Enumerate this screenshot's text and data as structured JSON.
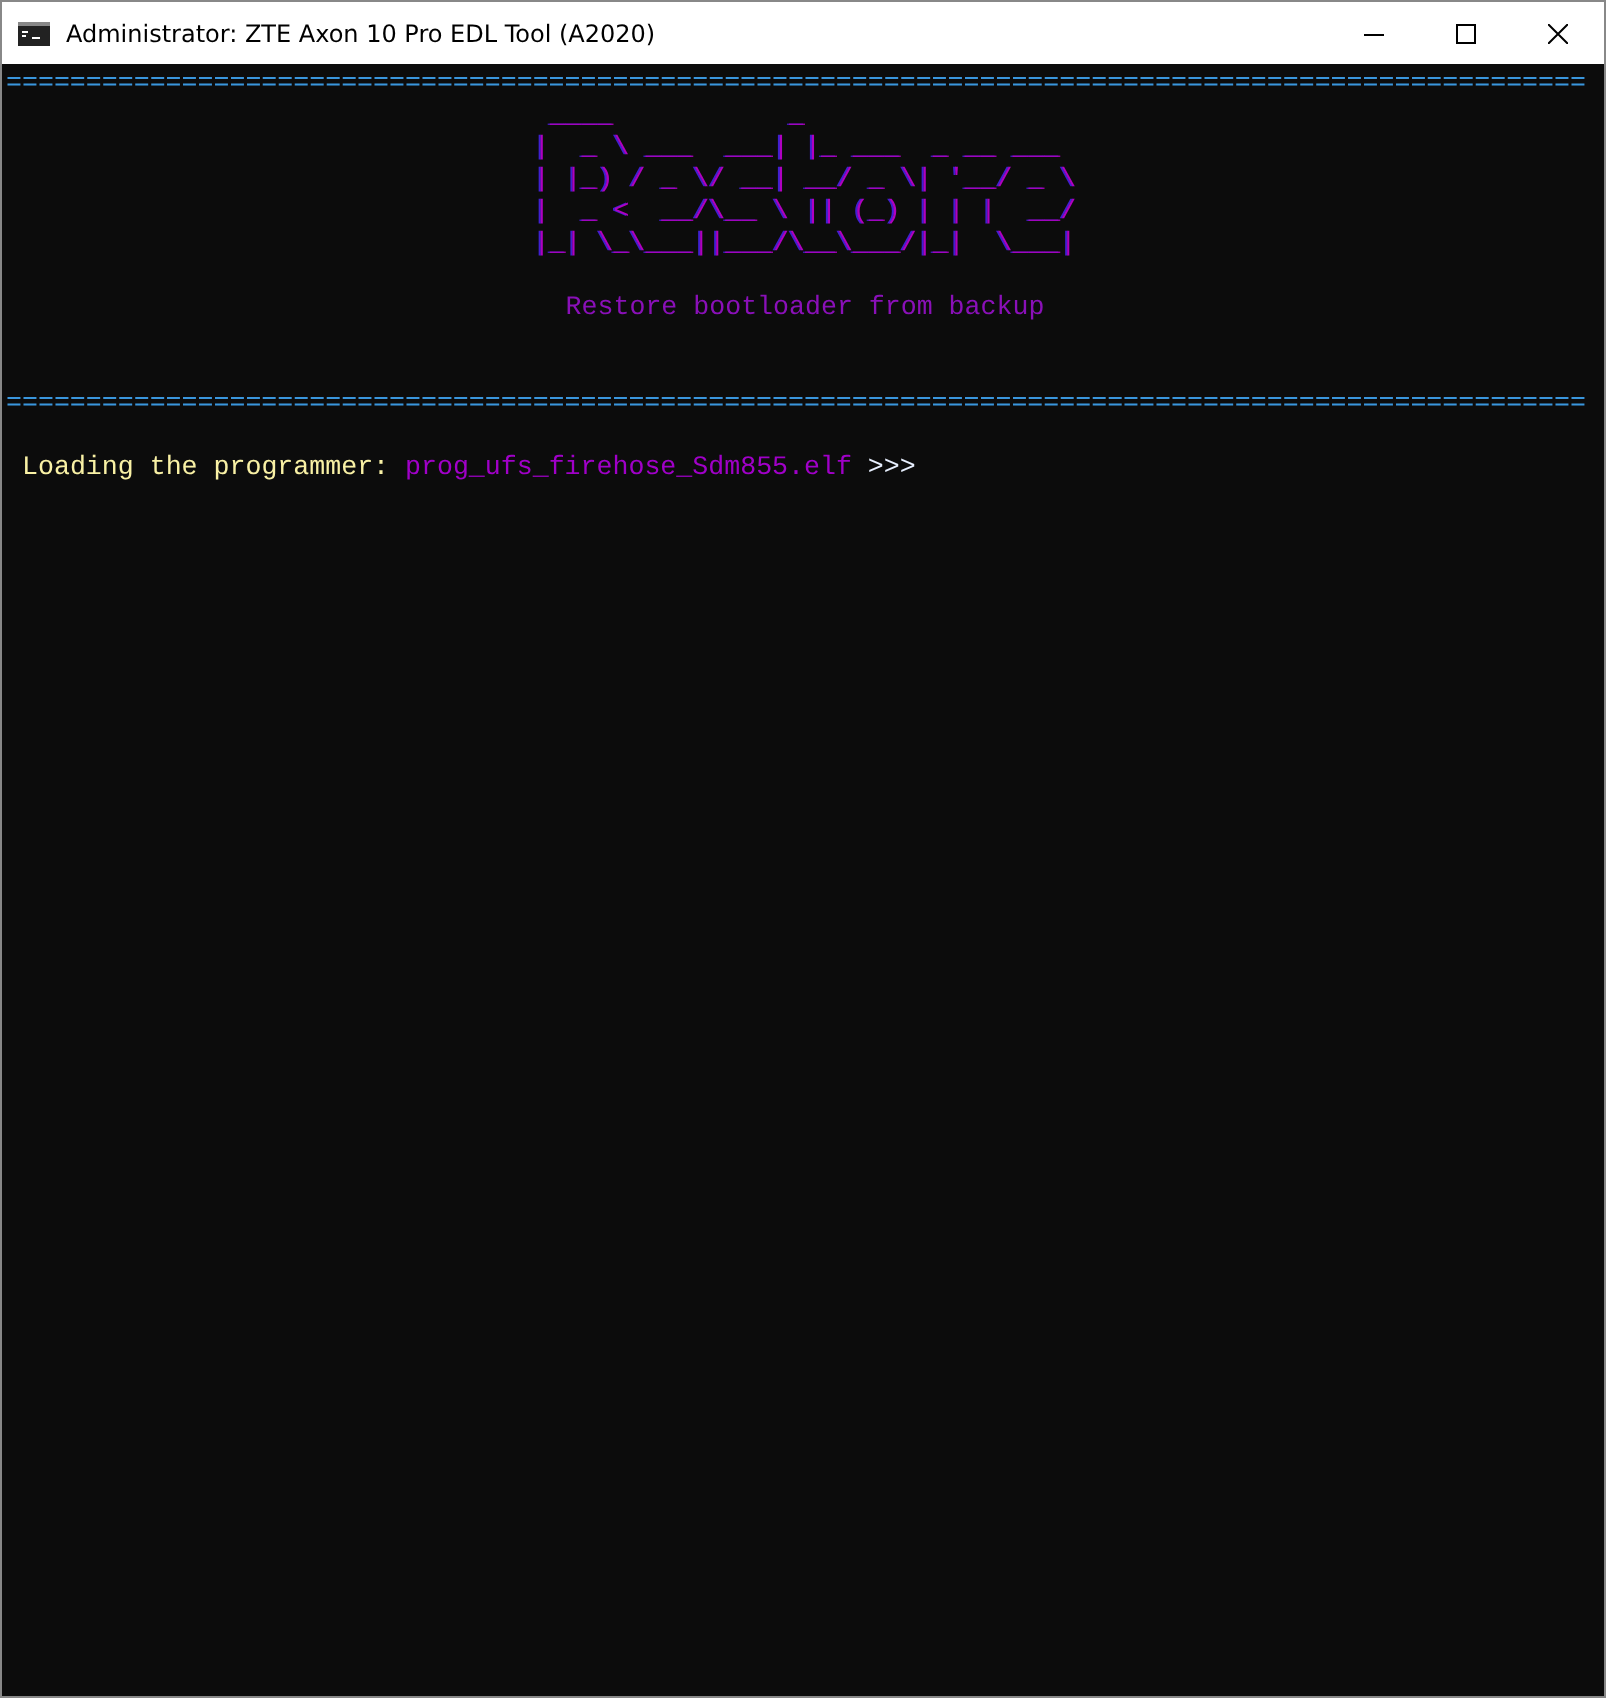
{
  "window": {
    "title": "Administrator:  ZTE Axon 10 Pro EDL Tool (A2020)"
  },
  "console": [
    {
      "kind": "rule",
      "text": "==================================================================================================="
    },
    {
      "kind": "art",
      "lines": [
        " ____           _                 ",
        "|  _ \\ ___  ___| |_ ___  _ __ ___ ",
        "| |_) / _ \\/ __| __/ _ \\| '__/ _ \\",
        "|  _ <  __/\\__ \\ || (_) | | |  __/",
        "|_| \\_\\___||___/\\__\\___/|_|  \\___|"
      ]
    },
    {
      "kind": "blank"
    },
    {
      "kind": "subtitle",
      "text": "Restore bootloader from backup"
    },
    {
      "kind": "blank"
    },
    {
      "kind": "blank"
    },
    {
      "kind": "rule",
      "text": "==================================================================================================="
    },
    {
      "kind": "blank"
    },
    {
      "kind": "segments",
      "segments": [
        {
          "text": "Loading the programmer: ",
          "color": "#f9f1a5"
        },
        {
          "text": "prog_ufs_firehose_Sdm855.elf",
          "color": "#a000c8"
        },
        {
          "text": " >>>",
          "color": "#e8f0ff"
        }
      ]
    }
  ]
}
